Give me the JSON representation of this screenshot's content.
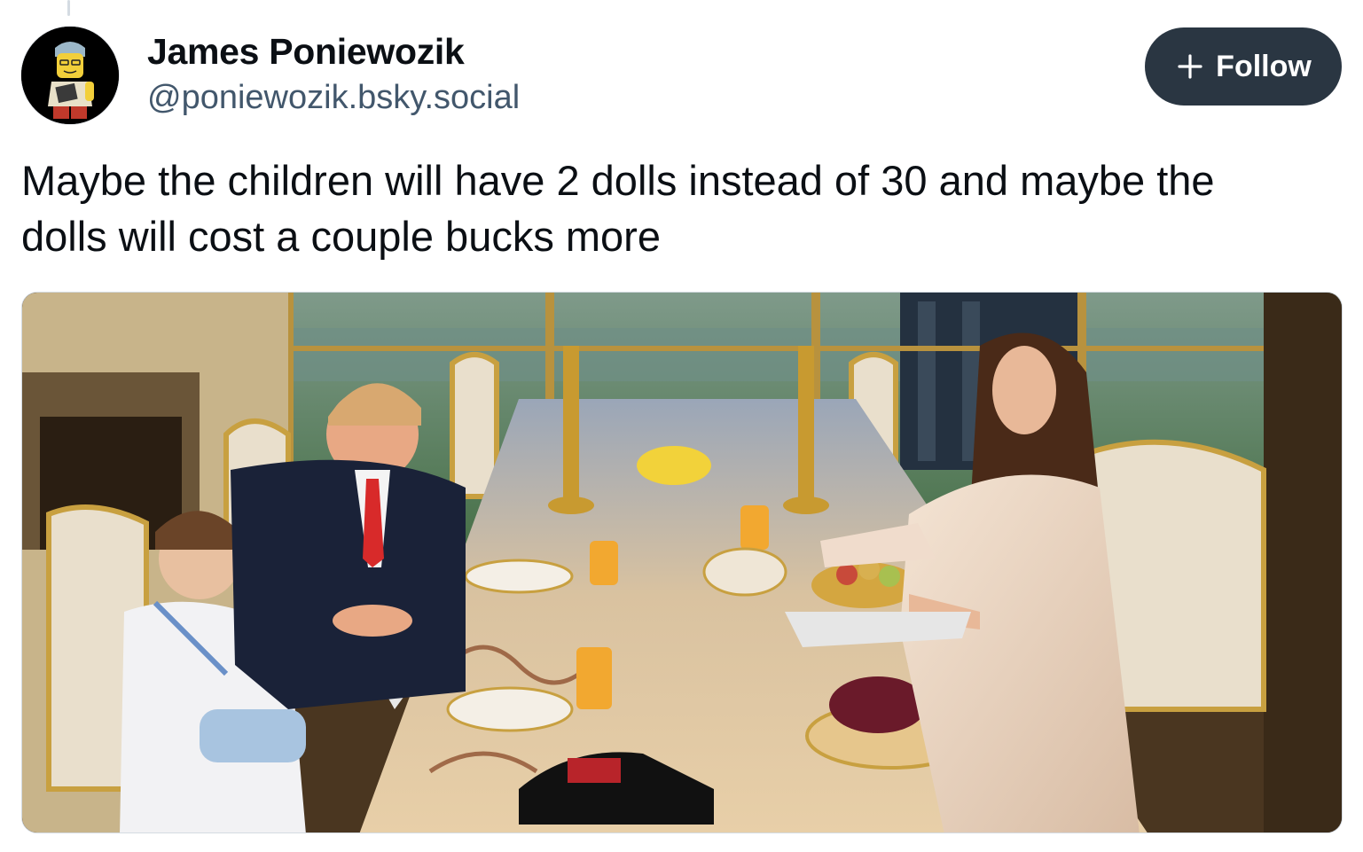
{
  "post": {
    "author": {
      "display_name": "James Poniewozik",
      "handle": "@poniewozik.bsky.social",
      "avatar_icon": "lego-minifigure-avatar"
    },
    "follow_button": {
      "label": "Follow",
      "icon": "plus-icon"
    },
    "text_lines": [
      "Maybe the children will have 2 dolls instead of 30 and maybe the",
      "dolls will cost a couple bucks more"
    ],
    "image": {
      "subject": "family-dining-photo"
    }
  },
  "colors": {
    "follow_bg": "#2a3642",
    "handle": "#42576c",
    "text": "#0b0f14"
  }
}
